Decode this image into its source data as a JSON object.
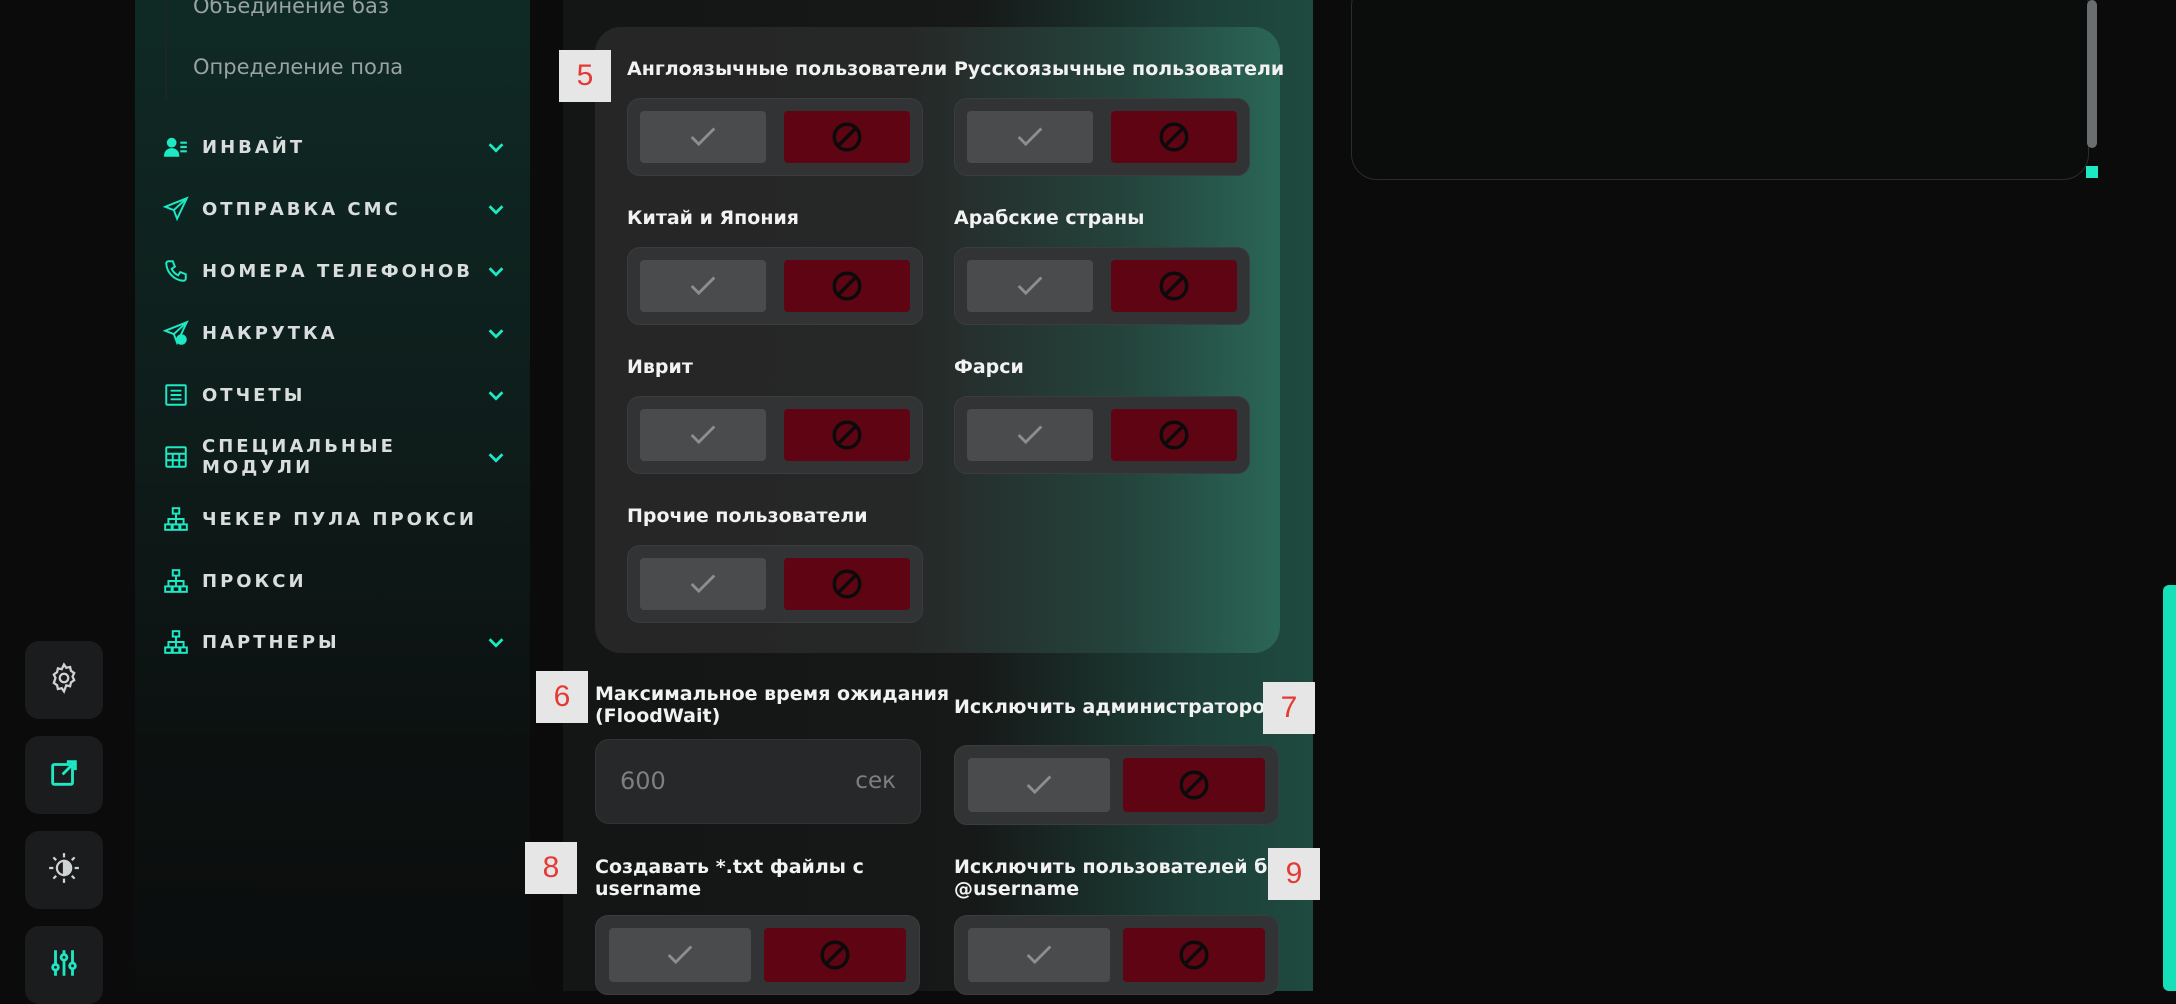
{
  "sidebar": {
    "sub_items": [
      "Объединение баз",
      "Определение пола"
    ],
    "nav": [
      {
        "label": "ИНВАЙТ",
        "icon": "user-list-icon",
        "expandable": true
      },
      {
        "label": "ОТПРАВКА СМС",
        "icon": "send-icon",
        "expandable": true
      },
      {
        "label": "НОМЕРА ТЕЛЕФОНОВ",
        "icon": "phone-icon",
        "expandable": true
      },
      {
        "label": "НАКРУТКА",
        "icon": "send-plus-icon",
        "expandable": true
      },
      {
        "label": "ОТЧЕТЫ",
        "icon": "report-icon",
        "expandable": true
      },
      {
        "label": "СПЕЦИАЛЬНЫЕ МОДУЛИ",
        "icon": "table-icon",
        "expandable": true
      },
      {
        "label": "ЧЕКЕР ПУЛА ПРОКСИ",
        "icon": "network-icon",
        "expandable": false
      },
      {
        "label": "ПРОКСИ",
        "icon": "network-icon",
        "expandable": false
      },
      {
        "label": "ПАРТНЕРЫ",
        "icon": "network-icon",
        "expandable": true
      }
    ]
  },
  "rail": [
    "gear-icon",
    "external-link-icon",
    "theme-icon",
    "sliders-icon"
  ],
  "languages": {
    "badge": "5",
    "items": [
      {
        "label": "Англоязычные пользователи"
      },
      {
        "label": "Русскоязычные пользователи"
      },
      {
        "label": "Китай и Япония"
      },
      {
        "label": "Арабские страны"
      },
      {
        "label": "Иврит"
      },
      {
        "label": "Фарси"
      },
      {
        "label": "Прочие пользователи"
      }
    ]
  },
  "floodwait": {
    "badge": "6",
    "label_line1": "Максимальное время ожидания",
    "label_line2": "(FloodWait)",
    "value": "600",
    "unit": "сек"
  },
  "exclude_admins": {
    "badge": "7",
    "label": "Исключить администраторов"
  },
  "create_txt": {
    "badge": "8",
    "label_line1": "Создавать *.txt файлы с",
    "label_line2": "username"
  },
  "exclude_no_username": {
    "badge": "9",
    "label_line1": "Исключить пользователей без",
    "label_line2": "@username"
  },
  "colors": {
    "accent": "#1de9c4",
    "deny": "#5e0412",
    "allow": "#4a4b4c"
  }
}
